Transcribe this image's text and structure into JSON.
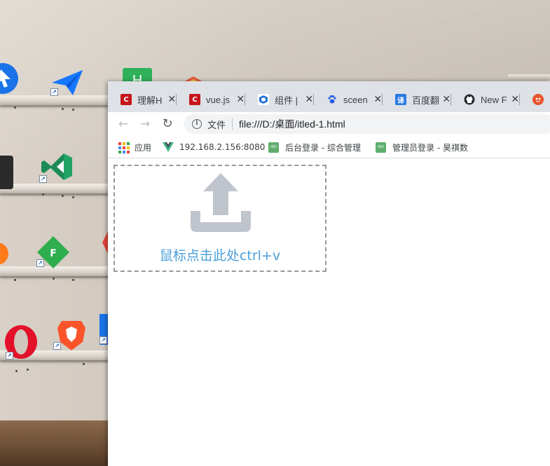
{
  "browser": {
    "tabs": [
      {
        "title": "理解H",
        "favicon": "red-c-icon",
        "color": "#c4161c"
      },
      {
        "title": "vue.js",
        "favicon": "red-c-icon",
        "color": "#c4161c"
      },
      {
        "title": "组件 |",
        "favicon": "cube-icon",
        "color": "#1e6fd9"
      },
      {
        "title": "sceen",
        "favicon": "paw-icon",
        "color": "#2a5ce6"
      },
      {
        "title": "百度翻",
        "favicon": "translate-icon",
        "color": "#2a7ae2"
      },
      {
        "title": "New F",
        "favicon": "github-icon",
        "color": "#24292e"
      }
    ],
    "close_glyph": "✕",
    "toolbar": {
      "back": "←",
      "forward": "→",
      "reload": "↻"
    },
    "omnibox": {
      "scheme_label": "文件",
      "url": "file:///D:/桌面/itled-1.html"
    },
    "bookmarks": [
      {
        "label": "应用"
      },
      {
        "label": "192.168.2.156:8080"
      },
      {
        "label": "后台登录 - 综合管理"
      },
      {
        "label": "管理员登录 - 昊祺数"
      }
    ]
  },
  "page": {
    "paste_hint": "鼠标点击此处ctrl+v"
  },
  "colors": {
    "accent_text": "#4a9fd8",
    "upload_icon": "#c0c4cc",
    "tabstrip": "#dee1e6"
  }
}
